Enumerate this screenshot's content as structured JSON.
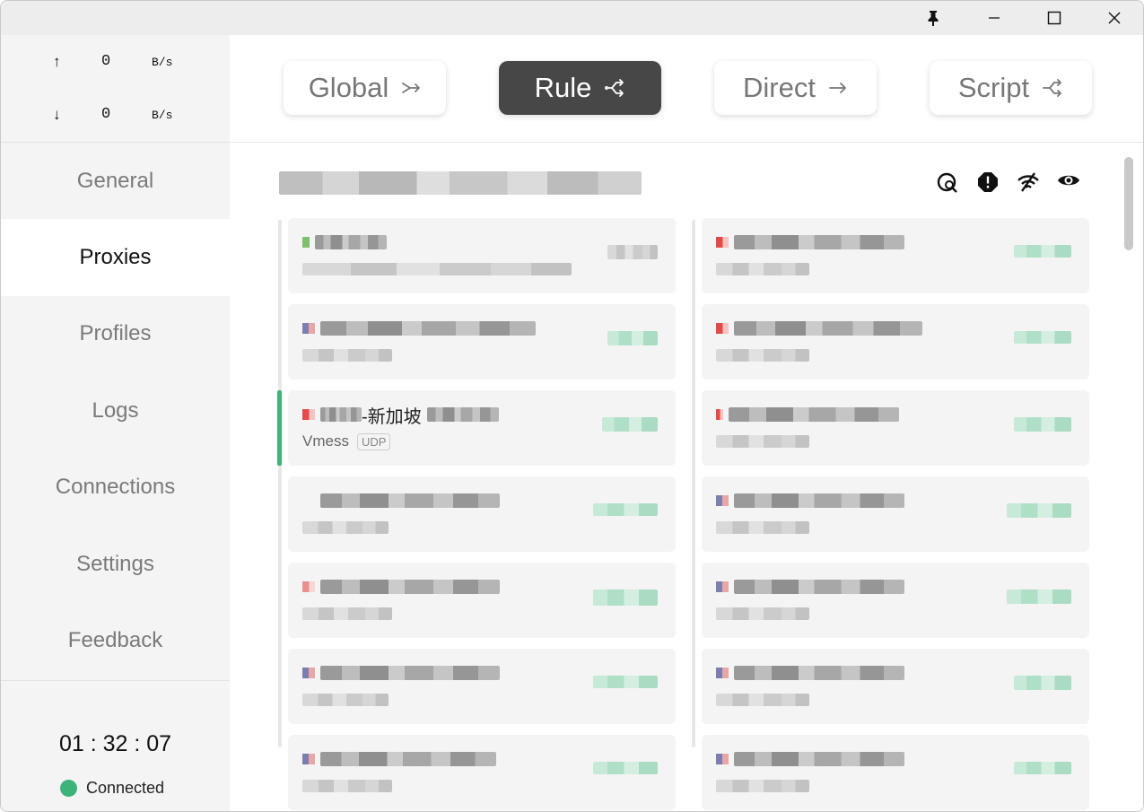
{
  "titlebar": {
    "icons": [
      "pin-icon",
      "minimize-icon",
      "maximize-icon",
      "close-icon"
    ]
  },
  "traffic": {
    "up_arrow": "↑",
    "up_value": "0",
    "up_unit": "B/s",
    "down_arrow": "↓",
    "down_value": "0",
    "down_unit": "B/s"
  },
  "nav": {
    "items": [
      {
        "label": "General"
      },
      {
        "label": "Proxies"
      },
      {
        "label": "Profiles"
      },
      {
        "label": "Logs"
      },
      {
        "label": "Connections"
      },
      {
        "label": "Settings"
      },
      {
        "label": "Feedback"
      }
    ],
    "active": "Proxies"
  },
  "status": {
    "uptime": "01 : 32 : 07",
    "connection": "Connected",
    "connection_color": "#3db27a"
  },
  "modes": [
    {
      "label": "Global",
      "icon": "global-mode-icon"
    },
    {
      "label": "Rule",
      "icon": "rule-mode-icon"
    },
    {
      "label": "Direct",
      "icon": "direct-mode-icon"
    },
    {
      "label": "Script",
      "icon": "script-mode-icon"
    }
  ],
  "active_mode": "Rule",
  "group_tools": [
    "latency-test-icon",
    "alert-icon",
    "wifi-icon",
    "eye-icon"
  ],
  "selected_proxy": {
    "name_suffix": "-新加坡",
    "type": "Vmess",
    "tag": "UDP"
  },
  "colors": {
    "accent": "#3db27a",
    "active_mode_bg": "#474747",
    "card_bg": "#f4f4f4",
    "sidebar_bg": "#f4f4f4"
  }
}
